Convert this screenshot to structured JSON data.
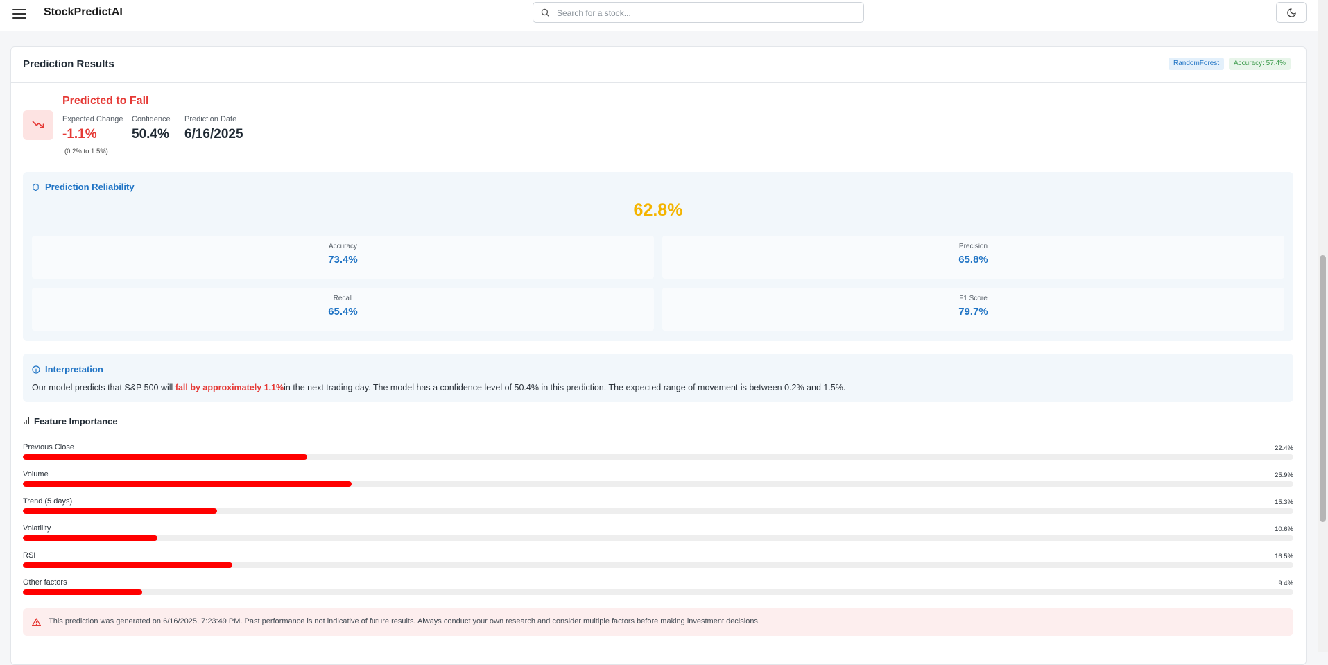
{
  "app": {
    "title": "StockPredictAI"
  },
  "search": {
    "placeholder": "Search for a stock..."
  },
  "results": {
    "title": "Prediction Results",
    "model_badge": "RandomForest",
    "accuracy_badge": "Accuracy: 57.4%",
    "prediction_title": "Predicted to Fall",
    "expected_change_label": "Expected Change",
    "expected_change_value": "-1.1%",
    "expected_range": "(0.2% to 1.5%)",
    "confidence_label": "Confidence",
    "confidence_value": "50.4%",
    "prediction_date_label": "Prediction Date",
    "prediction_date_value": "6/16/2025"
  },
  "reliability": {
    "title": "Prediction Reliability",
    "score": "62.8%",
    "metrics": [
      {
        "label": "Accuracy",
        "value": "73.4%"
      },
      {
        "label": "Precision",
        "value": "65.8%"
      },
      {
        "label": "Recall",
        "value": "65.4%"
      },
      {
        "label": "F1 Score",
        "value": "79.7%"
      }
    ]
  },
  "interpretation": {
    "title": "Interpretation",
    "text_before": "Our model predicts that S&P 500 will ",
    "highlight": "fall by approximately 1.1%",
    "text_after": "in the next trading day. The model has a confidence level of 50.4% in this prediction. The expected range of movement is between 0.2% and 1.5%."
  },
  "features": {
    "title": "Feature Importance",
    "items": [
      {
        "name": "Previous Close",
        "pct": "22.4%"
      },
      {
        "name": "Volume",
        "pct": "25.9%"
      },
      {
        "name": "Trend (5 days)",
        "pct": "15.3%"
      },
      {
        "name": "Volatility",
        "pct": "10.6%"
      },
      {
        "name": "RSI",
        "pct": "16.5%"
      },
      {
        "name": "Other factors",
        "pct": "9.4%"
      }
    ]
  },
  "bar_scale_max_pct": 100,
  "disclaimer": "This prediction was generated on 6/16/2025, 7:23:49 PM. Past performance is not indicative of future results. Always conduct your own research and consider multiple factors before making investment decisions.",
  "colors": {
    "negative": "#e53935",
    "accent": "#1f73c4",
    "reliability_score": "#f4b400",
    "bar_fill": "#ff0000"
  },
  "icons": {
    "menu": "menu-icon",
    "search": "search-icon",
    "theme": "moon-icon",
    "trend": "trending-down-icon",
    "reliability": "shield-icon",
    "interpretation": "info-icon",
    "features": "bar-chart-icon",
    "warning": "alert-triangle-icon"
  }
}
